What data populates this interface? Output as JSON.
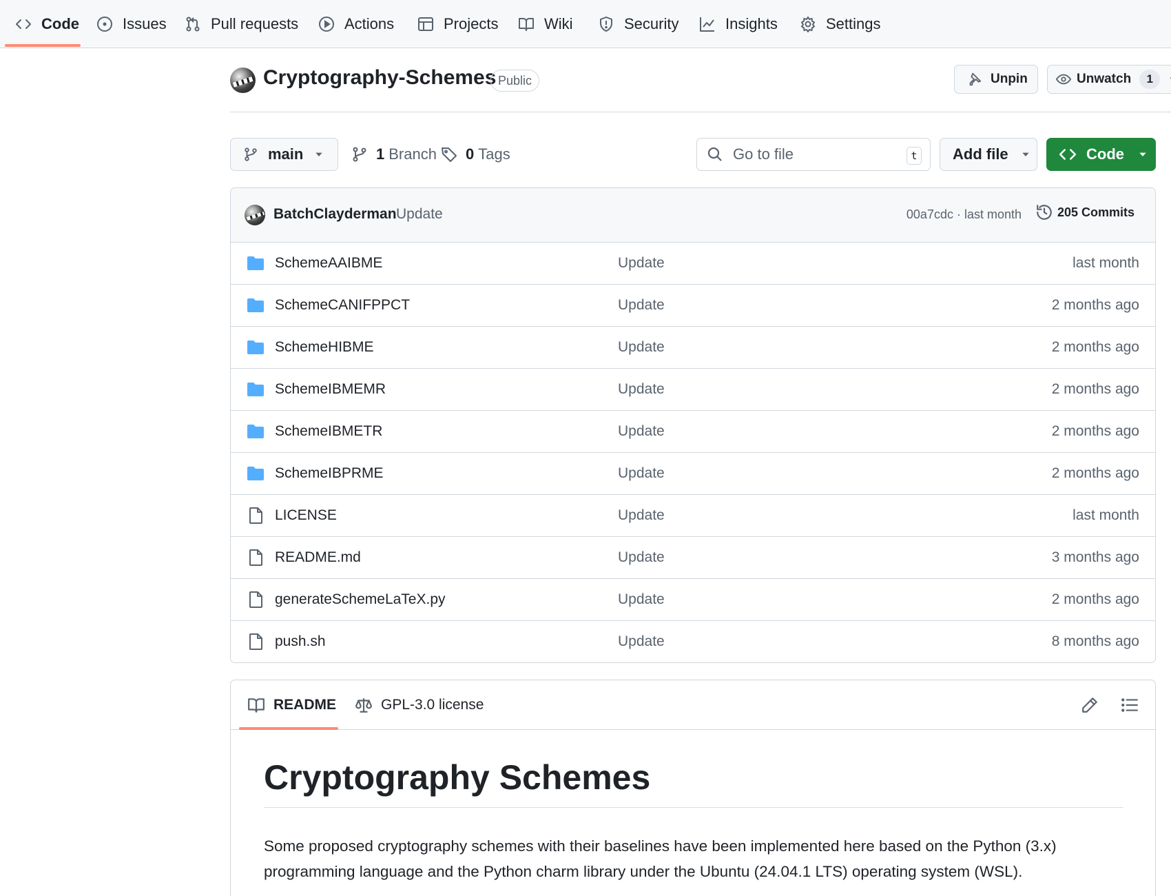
{
  "nav": {
    "tabs": [
      {
        "label": "Code",
        "icon": "code-icon",
        "active": true
      },
      {
        "label": "Issues",
        "icon": "issue-opened-icon"
      },
      {
        "label": "Pull requests",
        "icon": "git-pull-request-icon"
      },
      {
        "label": "Actions",
        "icon": "play-icon"
      },
      {
        "label": "Projects",
        "icon": "table-icon"
      },
      {
        "label": "Wiki",
        "icon": "book-icon"
      },
      {
        "label": "Security",
        "icon": "shield-icon"
      },
      {
        "label": "Insights",
        "icon": "graph-icon"
      },
      {
        "label": "Settings",
        "icon": "gear-icon"
      }
    ]
  },
  "repo": {
    "name": "Cryptography-Schemes",
    "visibility": "Public",
    "unpin_label": "Unpin",
    "unwatch_label": "Unwatch",
    "watch_count": "1"
  },
  "branchbar": {
    "branch": "main",
    "branch_count": "1",
    "branch_label": "Branch",
    "tag_count": "0",
    "tag_label": "Tags",
    "search_placeholder": "Go to file",
    "search_shortcut": "t",
    "add_file_label": "Add file",
    "code_label": "Code"
  },
  "commit": {
    "author": "BatchClayderman",
    "message": "Update",
    "meta": "00a7cdc · last month",
    "count_label": "205 Commits"
  },
  "files": [
    {
      "type": "dir",
      "name": "SchemeAAIBME",
      "message": "Update",
      "date": "last month"
    },
    {
      "type": "dir",
      "name": "SchemeCANIFPPCT",
      "message": "Update",
      "date": "2 months ago"
    },
    {
      "type": "dir",
      "name": "SchemeHIBME",
      "message": "Update",
      "date": "2 months ago"
    },
    {
      "type": "dir",
      "name": "SchemeIBMEMR",
      "message": "Update",
      "date": "2 months ago"
    },
    {
      "type": "dir",
      "name": "SchemeIBMETR",
      "message": "Update",
      "date": "2 months ago"
    },
    {
      "type": "dir",
      "name": "SchemeIBPRME",
      "message": "Update",
      "date": "2 months ago"
    },
    {
      "type": "file",
      "name": "LICENSE",
      "message": "Update",
      "date": "last month"
    },
    {
      "type": "file",
      "name": "README.md",
      "message": "Update",
      "date": "3 months ago"
    },
    {
      "type": "file",
      "name": "generateSchemeLaTeX.py",
      "message": "Update",
      "date": "2 months ago"
    },
    {
      "type": "file",
      "name": "push.sh",
      "message": "Update",
      "date": "8 months ago"
    }
  ],
  "readme": {
    "tab_readme": "README",
    "tab_license": "GPL-3.0 license",
    "heading": "Cryptography Schemes",
    "paragraph": "Some proposed cryptography schemes with their baselines have been implemented here based on the Python (3.x) programming language and the Python charm library under the Ubuntu (24.04.1 LTS) operating system (WSL)."
  },
  "colors": {
    "accent_underline": "#fd8c73",
    "primary_button": "#1f883d",
    "folder_icon": "#54aeff",
    "muted_text": "#59636e"
  }
}
